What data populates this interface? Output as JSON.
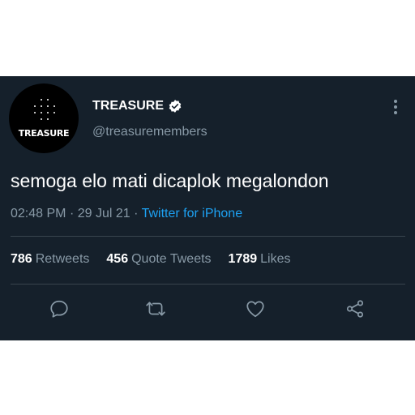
{
  "user": {
    "avatar_logo_text": "TREASURE",
    "name": "TREASURE",
    "handle": "@treasuremembers"
  },
  "tweet": {
    "text": "semoga elo mati dicaplok megalondon",
    "time": "02:48 PM",
    "separator": "·",
    "date": "29 Jul 21",
    "source": "Twitter for iPhone"
  },
  "stats": {
    "retweets_count": "786",
    "retweets_label": "Retweets",
    "quotes_count": "456",
    "quotes_label": "Quote Tweets",
    "likes_count": "1789",
    "likes_label": "Likes"
  },
  "icons": {
    "verified": "verified-badge-icon",
    "more": "more-options-icon",
    "reply": "reply-icon",
    "retweet": "retweet-icon",
    "like": "like-icon",
    "share": "share-icon"
  },
  "colors": {
    "background": "#15202b",
    "secondary_text": "#8899a6",
    "link": "#1da1f2",
    "divider": "#38444d"
  }
}
